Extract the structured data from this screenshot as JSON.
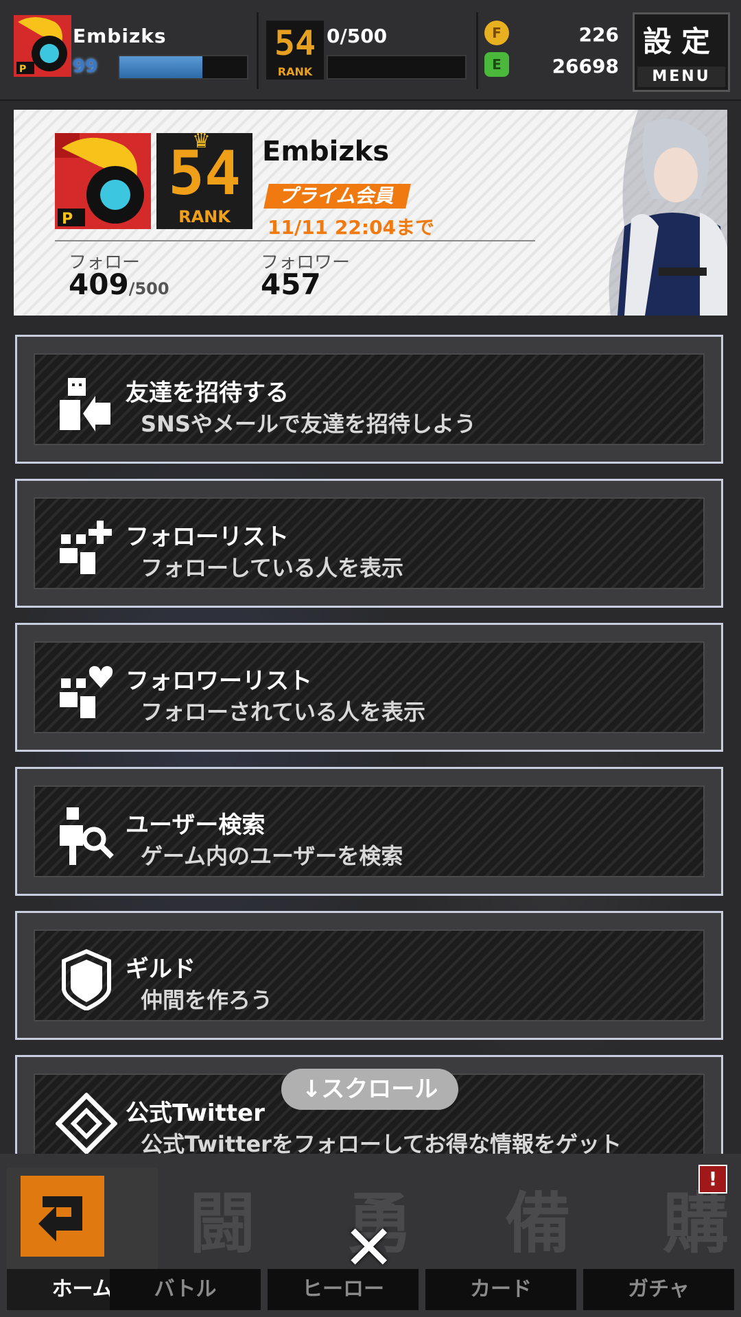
{
  "header": {
    "player_name": "Embizks",
    "level": "99",
    "exp_fill": 0.65,
    "rank": "54",
    "rank_label": "RANK",
    "rank_progress": "0/500",
    "coin_label": "F",
    "coin_value": "226",
    "energy_label": "E",
    "energy_value": "26698",
    "menu_kanji": "設定",
    "menu_label": "MENU"
  },
  "profile": {
    "name": "Embizks",
    "rank": "54",
    "rank_label": "RANK",
    "prime_badge": "プライム会員",
    "prime_until": "11/11 22:04まで",
    "follow_label": "フォロー",
    "follow_value": "409",
    "follow_max": "/500",
    "follower_label": "フォロワー",
    "follower_value": "457"
  },
  "menu_items": [
    {
      "title": "友達を招待する",
      "subtitle": "SNSやメールで友達を招待しよう",
      "icon": "invite-friend-icon"
    },
    {
      "title": "フォローリスト",
      "subtitle": "フォローしている人を表示",
      "icon": "follow-list-icon"
    },
    {
      "title": "フォロワーリスト",
      "subtitle": "フォローされている人を表示",
      "icon": "follower-list-icon"
    },
    {
      "title": "ユーザー検索",
      "subtitle": "ゲーム内のユーザーを検索",
      "icon": "user-search-icon"
    },
    {
      "title": "ギルド",
      "subtitle": "仲間を作ろう",
      "icon": "guild-shield-icon"
    },
    {
      "title": "公式Twitter",
      "subtitle": "公式Twitterをフォローしてお得な情報をゲット",
      "icon": "official-logo-icon"
    }
  ],
  "scroll_hint": "↓スクロール",
  "nav": {
    "home": "ホーム",
    "battle_kanji": "闘",
    "battle": "バトル",
    "hero_kanji": "勇",
    "hero": "ヒーロー",
    "card_kanji": "備",
    "card": "カード",
    "gacha_kanji": "購",
    "gacha": "ガチャ",
    "alert": "!",
    "close": "✕"
  },
  "colors": {
    "accent": "#f07a10",
    "exp_bar": "#3c7cbc",
    "menu_border": "#c8cde0"
  }
}
